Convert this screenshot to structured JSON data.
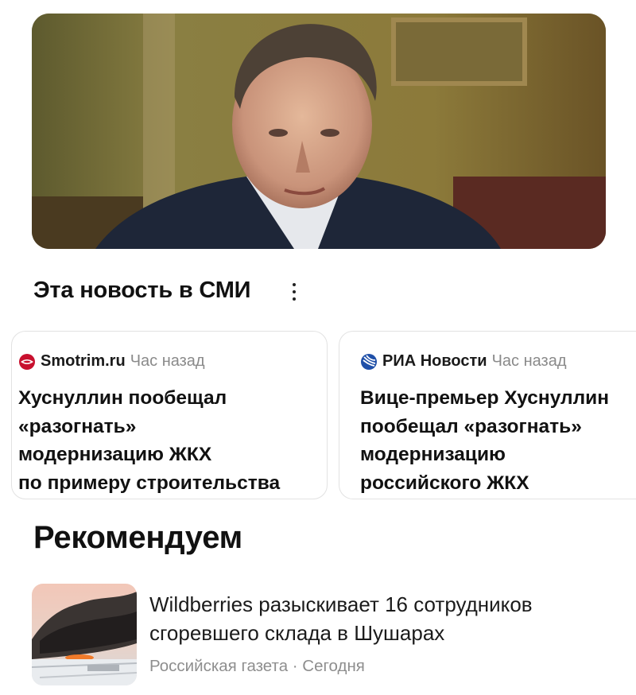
{
  "hero": {
    "image": "portrait-photo"
  },
  "media_section": {
    "title": "Эта новость в СМИ",
    "menu_icon": "more-vertical-icon"
  },
  "media_cards": [
    {
      "source": "Smotrim.ru",
      "source_icon": "smotrim-logo-icon",
      "time": "Час назад",
      "title": "Хуснуллин пообещал\n«разогнать»\nмодернизацию ЖКХ\nпо примеру строительства"
    },
    {
      "source": "РИА Новости",
      "source_icon": "ria-logo-icon",
      "time": "Час назад",
      "title": "Вице-премьер Хуснуллин\nпообещал «разогнать»\nмодернизацию\nроссийского ЖКХ"
    }
  ],
  "recommend": {
    "title": "Рекомендуем",
    "items": [
      {
        "thumb": "warehouse-fire-photo",
        "headline": "Wildberries разыскивает 16 сотрудников\nсгоревшего склада в Шушарах",
        "meta": "Российская газета · Сегодня"
      }
    ]
  },
  "colors": {
    "smotrim": "#c8102e",
    "ria": "#1f4fa8",
    "muted": "#8a8a8a"
  }
}
